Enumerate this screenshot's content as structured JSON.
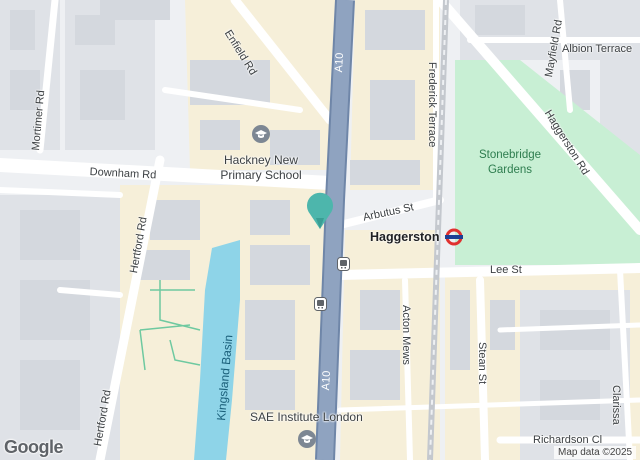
{
  "map": {
    "colors": {
      "land": "#eef0f3",
      "block": "#dfe2e7",
      "building": "#d4d8de",
      "urban_yellow": "#f6efd9",
      "park": "#c8efd4",
      "water": "#8ed4e8",
      "main_road": "#8fa3c0",
      "minor_road": "#ffffff",
      "marker": "#4db6ac",
      "station_red": "#e0312f",
      "station_blue": "#1c3f94"
    },
    "roads": {
      "a10_top": "A10",
      "a10_bottom": "A10",
      "enfield": "Enfield Rd",
      "mortimer": "Mortimer Rd",
      "downham": "Downham Rd",
      "hertford_upper": "Hertford Rd",
      "hertford_lower": "Hertford Rd",
      "frederick": "Frederick Terrace",
      "arbutus": "Arbutus St",
      "lee": "Lee St",
      "acton": "Acton Mews",
      "stean": "Stean St",
      "mayfield": "Mayfield Rd",
      "albion": "Albion Terrace",
      "haggerston_rd": "Haggerston Rd",
      "richardson": "Richardson Cl",
      "clarissa": "Clarissa"
    },
    "places": {
      "school_line1": "Hackney New",
      "school_line2": "Primary School",
      "park_line1": "Stonebridge",
      "park_line2": "Gardens",
      "station": "Haggerston",
      "basin": "Kingsland Basin",
      "sae": "SAE Institute London"
    },
    "icons": {
      "school": "school-icon",
      "sae": "school-icon",
      "station": "underground-roundel-icon",
      "marker": "location-pin-icon",
      "bus1": "bus-stop-icon",
      "bus2": "bus-stop-icon"
    },
    "attribution": {
      "logo": "Google",
      "data": "Map data ©2025"
    }
  }
}
